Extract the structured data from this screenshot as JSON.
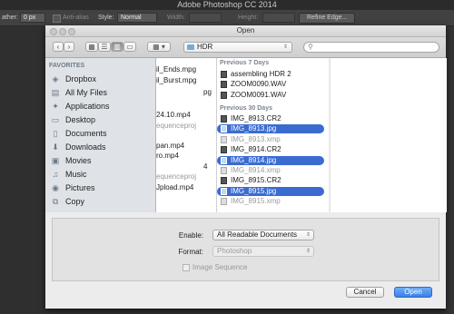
{
  "app": {
    "title": "Adobe Photoshop CC 2014"
  },
  "options_bar": {
    "feather_label": "ather:",
    "feather_value": "0 px",
    "anti_alias_label": "Anti-alias",
    "style_label": "Style:",
    "style_value": "Normal",
    "width_label": "Width:",
    "height_label": "Height:",
    "refine_edge_label": "Refine Edge..."
  },
  "dialog": {
    "title": "Open",
    "toolbar": {
      "back_icon": "chevron-left-icon",
      "forward_icon": "chevron-right-icon",
      "location": "HDR",
      "search_placeholder": ""
    },
    "sidebar": {
      "heading": "FAVORITES",
      "items": [
        {
          "label": "Dropbox",
          "icon": "dropbox-icon"
        },
        {
          "label": "All My Files",
          "icon": "all-files-icon"
        },
        {
          "label": "Applications",
          "icon": "applications-icon"
        },
        {
          "label": "Desktop",
          "icon": "desktop-icon"
        },
        {
          "label": "Documents",
          "icon": "documents-icon"
        },
        {
          "label": "Downloads",
          "icon": "downloads-icon"
        },
        {
          "label": "Movies",
          "icon": "movies-icon"
        },
        {
          "label": "Music",
          "icon": "music-icon"
        },
        {
          "label": "Pictures",
          "icon": "pictures-icon"
        },
        {
          "label": "Copy",
          "icon": "copy-icon"
        }
      ]
    },
    "column1": [
      {
        "text": "il_Ends.mpg",
        "dim": false
      },
      {
        "text": "il_Burst.mpg",
        "dim": false
      },
      {
        "text": "pg",
        "dim": false
      },
      {
        "text": "24.10.mp4",
        "dim": false
      },
      {
        "text": "equenceproj",
        "dim": true
      },
      {
        "text": "pan.mp4",
        "dim": false
      },
      {
        "text": "ro.mp4",
        "dim": false
      },
      {
        "text": "4",
        "dim": false
      },
      {
        "text": "equenceproj",
        "dim": true
      },
      {
        "text": "Jpload.mp4",
        "dim": false
      }
    ],
    "files": {
      "previous_7_days_label": "Previous 7 Days",
      "previous_7_days": [
        {
          "name": "assembling HDR 2",
          "state": "normal"
        },
        {
          "name": "ZOOM0090.WAV",
          "state": "normal"
        },
        {
          "name": "ZOOM0091.WAV",
          "state": "normal"
        }
      ],
      "previous_30_days_label": "Previous 30 Days",
      "previous_30_days": [
        {
          "name": "IMG_8913.CR2",
          "state": "normal"
        },
        {
          "name": "IMG_8913.jpg",
          "state": "selected"
        },
        {
          "name": "IMG_8913.xmp",
          "state": "dim"
        },
        {
          "name": "IMG_8914.CR2",
          "state": "normal"
        },
        {
          "name": "IMG_8914.jpg",
          "state": "selected"
        },
        {
          "name": "IMG_8914.xmp",
          "state": "dim"
        },
        {
          "name": "IMG_8915.CR2",
          "state": "normal"
        },
        {
          "name": "IMG_8915.jpg",
          "state": "selected"
        },
        {
          "name": "IMG_8915.xmp",
          "state": "dim"
        }
      ]
    },
    "options": {
      "enable_label": "Enable:",
      "enable_value": "All Readable Documents",
      "format_label": "Format:",
      "format_value": "Photoshop",
      "image_sequence_label": "Image Sequence"
    },
    "buttons": {
      "cancel": "Cancel",
      "open": "Open"
    }
  },
  "colors": {
    "selection": "#3a6bd1",
    "primary_button": "#3b7fe6"
  }
}
